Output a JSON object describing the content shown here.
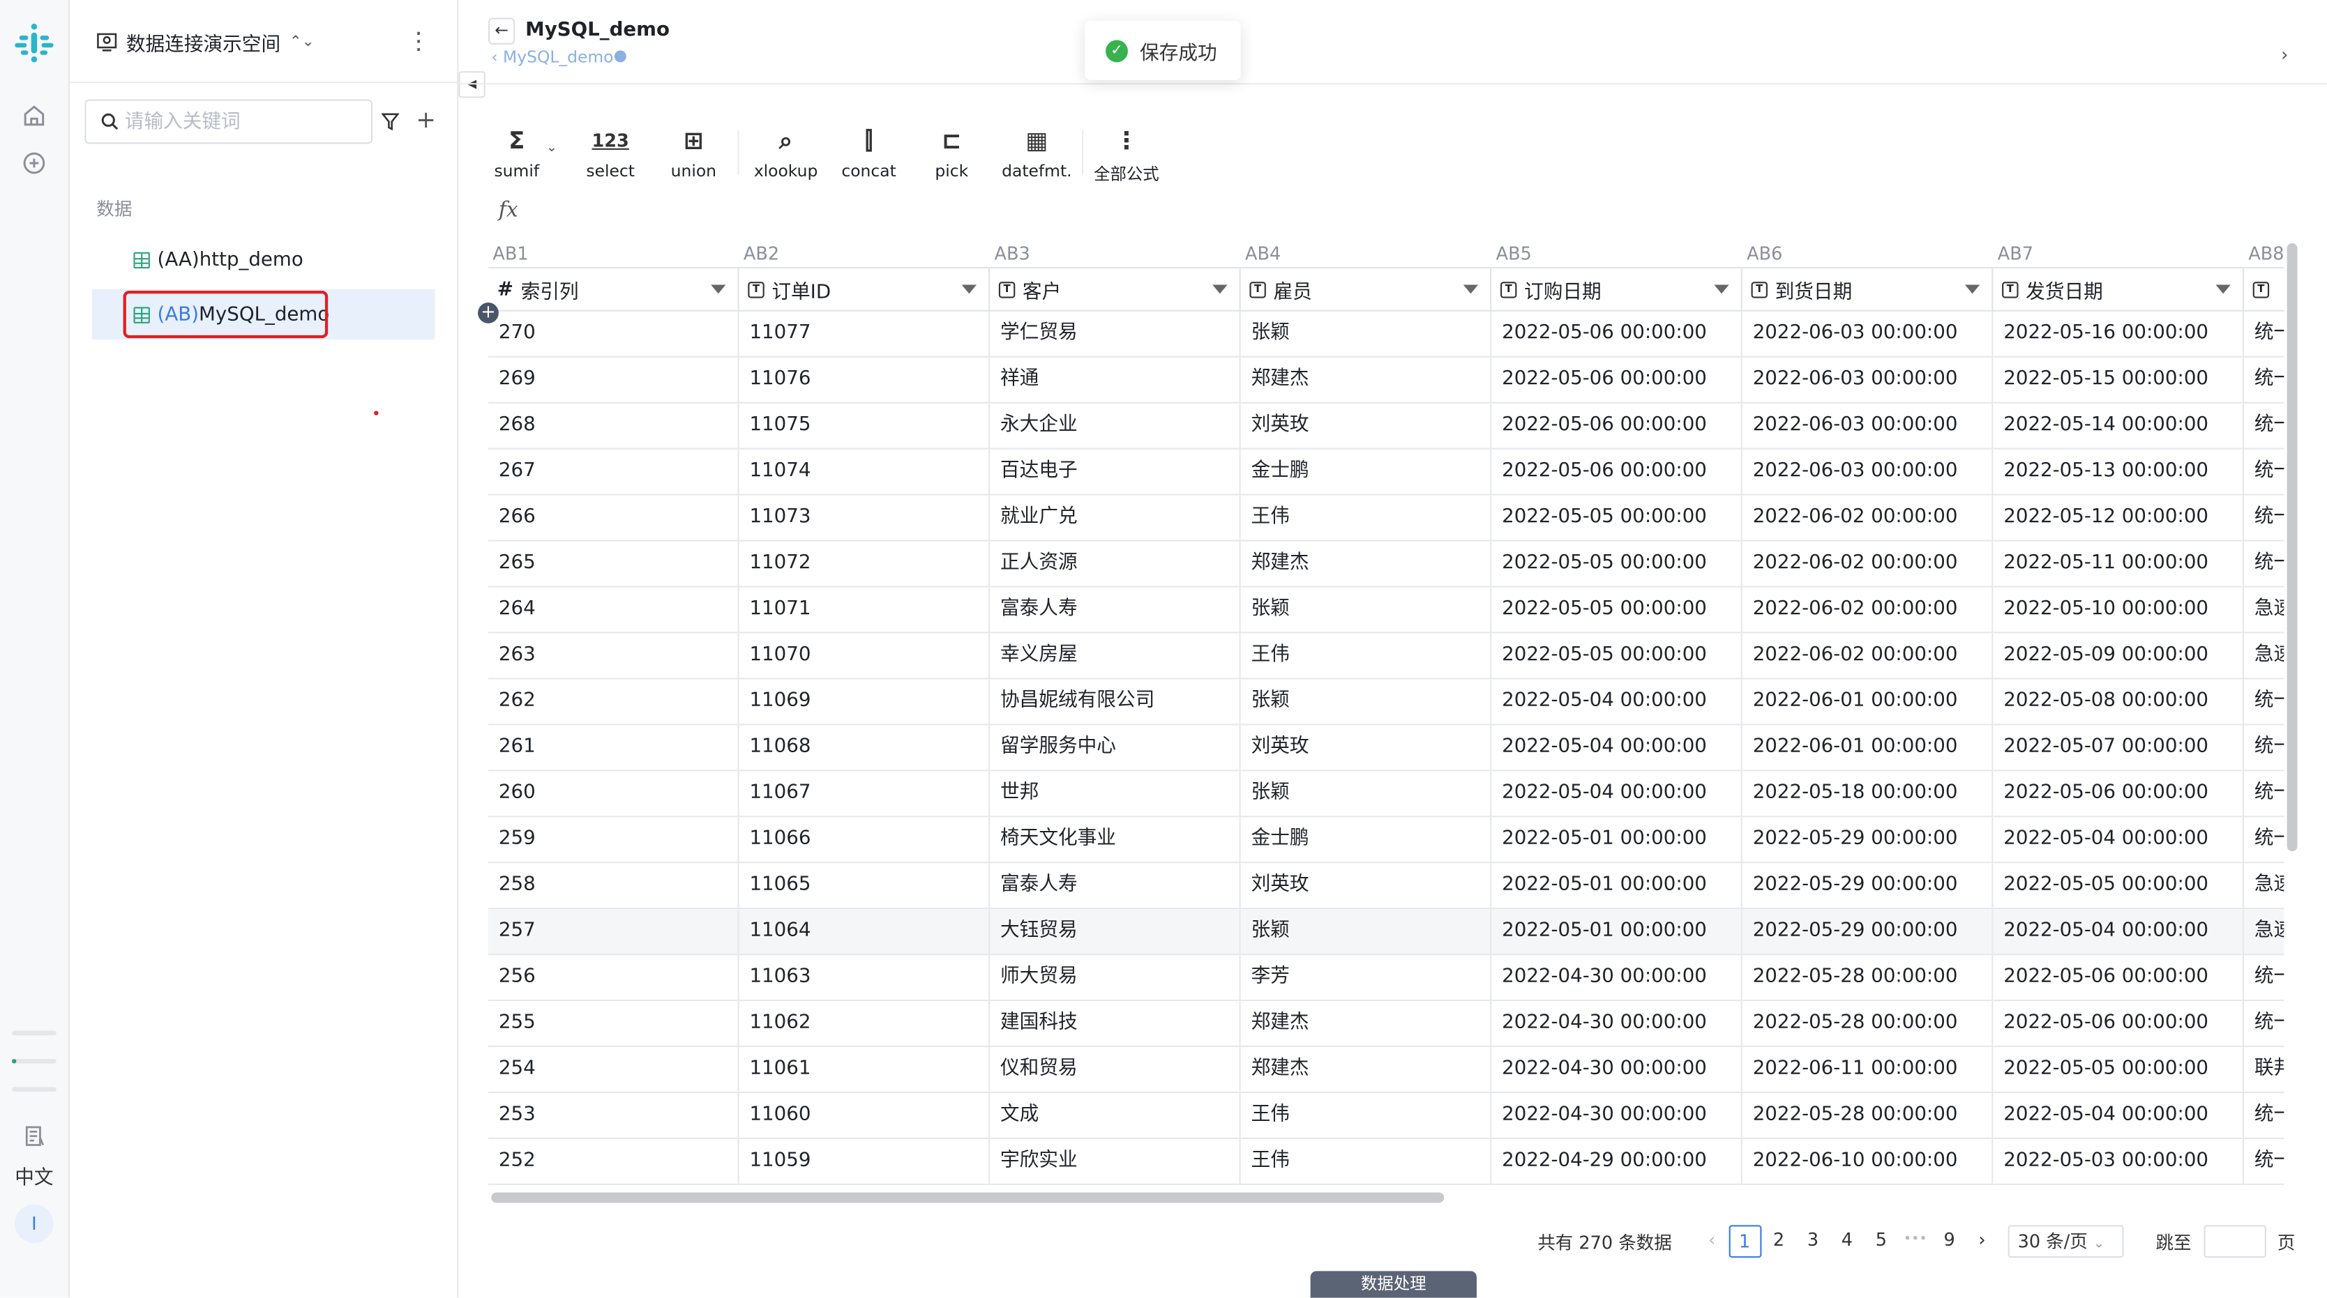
{
  "rail": {
    "lang": "中文",
    "user_initial": "I"
  },
  "sidebar": {
    "workspace": "数据连接演示空间",
    "search_placeholder": "请输入关键词",
    "section": "数据",
    "items": [
      {
        "prefix": "(AA)",
        "name": "http_demo"
      },
      {
        "prefix": "(AB)",
        "name": "MySQL_demo"
      }
    ]
  },
  "header": {
    "title": "MySQL_demo",
    "subtitle": "MySQL_demo"
  },
  "toast": {
    "message": "保存成功"
  },
  "toolbar": [
    {
      "icon": "Σ",
      "label": "sumif"
    },
    {
      "icon": "123",
      "label": "select"
    },
    {
      "icon": "⊞",
      "label": "union"
    },
    {
      "icon": "⌕",
      "label": "xlookup"
    },
    {
      "icon": "⫿",
      "label": "concat"
    },
    {
      "icon": "⊏",
      "label": "pick"
    },
    {
      "icon": "▦",
      "label": "datefmt."
    },
    {
      "icon": "⋮",
      "label": "全部公式"
    }
  ],
  "grid": {
    "col_refs": [
      "AB1",
      "AB2",
      "AB3",
      "AB4",
      "AB5",
      "AB6",
      "AB7",
      "AB8"
    ],
    "columns": [
      "索引列",
      "订单ID",
      "客户",
      "雇员",
      "订购日期",
      "到货日期",
      "发货日期",
      ""
    ],
    "rows": [
      [
        "270",
        "11077",
        "学仁贸易",
        "张颖",
        "2022-05-06 00:00:00",
        "2022-06-03 00:00:00",
        "2022-05-16 00:00:00",
        "统一"
      ],
      [
        "269",
        "11076",
        "祥通",
        "郑建杰",
        "2022-05-06 00:00:00",
        "2022-06-03 00:00:00",
        "2022-05-15 00:00:00",
        "统一"
      ],
      [
        "268",
        "11075",
        "永大企业",
        "刘英玫",
        "2022-05-06 00:00:00",
        "2022-06-03 00:00:00",
        "2022-05-14 00:00:00",
        "统一"
      ],
      [
        "267",
        "11074",
        "百达电子",
        "金士鹏",
        "2022-05-06 00:00:00",
        "2022-06-03 00:00:00",
        "2022-05-13 00:00:00",
        "统一"
      ],
      [
        "266",
        "11073",
        "就业广兑",
        "王伟",
        "2022-05-05 00:00:00",
        "2022-06-02 00:00:00",
        "2022-05-12 00:00:00",
        "统一"
      ],
      [
        "265",
        "11072",
        "正人资源",
        "郑建杰",
        "2022-05-05 00:00:00",
        "2022-06-02 00:00:00",
        "2022-05-11 00:00:00",
        "统一"
      ],
      [
        "264",
        "11071",
        "富泰人寿",
        "张颖",
        "2022-05-05 00:00:00",
        "2022-06-02 00:00:00",
        "2022-05-10 00:00:00",
        "急速"
      ],
      [
        "263",
        "11070",
        "幸义房屋",
        "王伟",
        "2022-05-05 00:00:00",
        "2022-06-02 00:00:00",
        "2022-05-09 00:00:00",
        "急速"
      ],
      [
        "262",
        "11069",
        "协昌妮绒有限公司",
        "张颖",
        "2022-05-04 00:00:00",
        "2022-06-01 00:00:00",
        "2022-05-08 00:00:00",
        "统一"
      ],
      [
        "261",
        "11068",
        "留学服务中心",
        "刘英玫",
        "2022-05-04 00:00:00",
        "2022-06-01 00:00:00",
        "2022-05-07 00:00:00",
        "统一"
      ],
      [
        "260",
        "11067",
        "世邦",
        "张颖",
        "2022-05-04 00:00:00",
        "2022-05-18 00:00:00",
        "2022-05-06 00:00:00",
        "统一"
      ],
      [
        "259",
        "11066",
        "椅天文化事业",
        "金士鹏",
        "2022-05-01 00:00:00",
        "2022-05-29 00:00:00",
        "2022-05-04 00:00:00",
        "统一"
      ],
      [
        "258",
        "11065",
        "富泰人寿",
        "刘英玫",
        "2022-05-01 00:00:00",
        "2022-05-29 00:00:00",
        "2022-05-05 00:00:00",
        "急速"
      ],
      [
        "257",
        "11064",
        "大钰贸易",
        "张颖",
        "2022-05-01 00:00:00",
        "2022-05-29 00:00:00",
        "2022-05-04 00:00:00",
        "急速"
      ],
      [
        "256",
        "11063",
        "师大贸易",
        "李芳",
        "2022-04-30 00:00:00",
        "2022-05-28 00:00:00",
        "2022-05-06 00:00:00",
        "统一"
      ],
      [
        "255",
        "11062",
        "建国科技",
        "郑建杰",
        "2022-04-30 00:00:00",
        "2022-05-28 00:00:00",
        "2022-05-06 00:00:00",
        "统一"
      ],
      [
        "254",
        "11061",
        "仪和贸易",
        "郑建杰",
        "2022-04-30 00:00:00",
        "2022-06-11 00:00:00",
        "2022-05-05 00:00:00",
        "联邦"
      ],
      [
        "253",
        "11060",
        "文成",
        "王伟",
        "2022-04-30 00:00:00",
        "2022-05-28 00:00:00",
        "2022-05-04 00:00:00",
        "统一"
      ],
      [
        "252",
        "11059",
        "宇欣实业",
        "王伟",
        "2022-04-29 00:00:00",
        "2022-06-10 00:00:00",
        "2022-05-03 00:00:00",
        "统一"
      ]
    ]
  },
  "pager": {
    "total": "共有 270 条数据",
    "pages": [
      "1",
      "2",
      "3",
      "4",
      "5",
      "•••",
      "9"
    ],
    "current": "1",
    "page_size": "30 条/页",
    "jump_label": "跳至",
    "page_unit": "页"
  },
  "process_button": "数据处理"
}
